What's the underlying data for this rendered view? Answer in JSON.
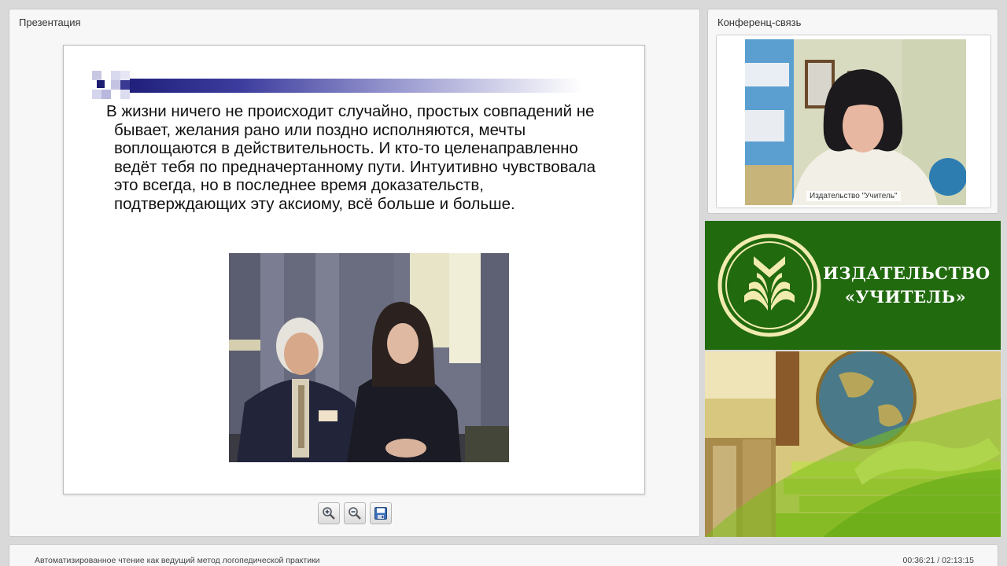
{
  "presentation": {
    "title": "Презентация",
    "slide": {
      "text": "В жизни ничего не происходит случайно, простых совпадений не бывает, желания  рано или поздно исполняются, мечты воплощаются в действительность. И кто-то целенаправленно ведёт тебя по предначертанному пути. Интуитивно чувствовала это всегда, но в последнее время доказательств, подтверждающих эту аксиому, всё больше и больше."
    },
    "toolbar": {
      "zoom_in": "zoom-in-icon",
      "zoom_out": "zoom-out-icon",
      "save": "save-icon"
    }
  },
  "conference": {
    "title": "Конференц-связь",
    "caption": "Издательство \"Учитель\""
  },
  "brand": {
    "name_line1": "ИЗДАТЕЛЬСТВО",
    "name_line2": "«УЧИТЕЛЬ»",
    "color": "#216a0e"
  },
  "footer": {
    "title": "Автоматизированное чтение как ведущий метод логопедической практики",
    "time": "00:36:21 / 02:13:15"
  }
}
